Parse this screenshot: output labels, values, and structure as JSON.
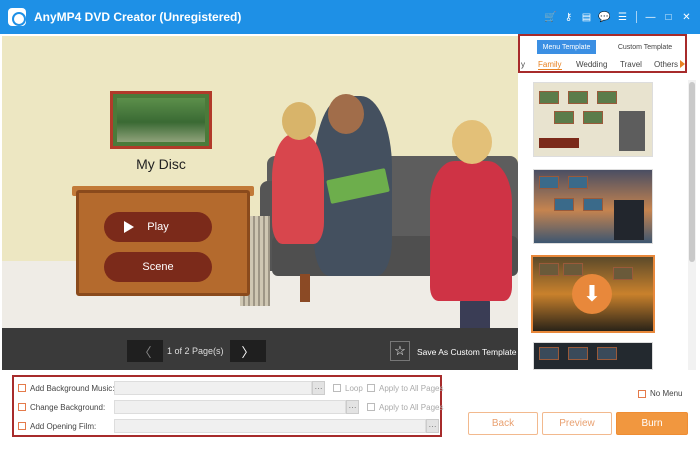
{
  "app": {
    "title": "AnyMP4 DVD Creator (Unregistered)"
  },
  "titlebar_icons": [
    "cart-icon",
    "key-icon",
    "document-icon",
    "chat-icon",
    "menu-icon",
    "minimize-icon",
    "maximize-icon",
    "close-icon"
  ],
  "titlebar_glyphs": {
    "cart": "🛒",
    "key": "⚷",
    "document": "▤",
    "chat": "💬",
    "menu": "☰",
    "minimize": "—",
    "maximize": "□",
    "close": "✕"
  },
  "preview": {
    "disc_title": "My Disc",
    "play_label": "Play",
    "scene_label": "Scene"
  },
  "nav": {
    "prev_glyph": "〈",
    "next_glyph": "〉",
    "page_info": "1 of 2 Page(s)",
    "save_star": "☆",
    "save_label": "Save As Custom Template"
  },
  "templates": {
    "tabs": {
      "menu": "Menu Template",
      "custom": "Custom Template"
    },
    "categories": {
      "partial": "y",
      "family": "Family",
      "wedding": "Wedding",
      "travel": "Travel",
      "others": "Others"
    },
    "active_category": "Family",
    "download_glyph": "⬇"
  },
  "options": {
    "background_music": {
      "label": "Add Background Music:",
      "more": "···",
      "loop": "Loop",
      "apply_all": "Apply to All Pages"
    },
    "change_background": {
      "label": "Change Background:",
      "more": "···",
      "apply_all": "Apply to All Pages"
    },
    "opening_film": {
      "label": "Add Opening Film:",
      "more": "···"
    }
  },
  "no_menu": "No Menu",
  "buttons": {
    "back": "Back",
    "preview": "Preview",
    "burn": "Burn"
  },
  "colors": {
    "titlebar": "#1e90e6",
    "accent_orange": "#f1973f",
    "highlight_frame": "#a72b2b",
    "tab_active": "#3b8fe3"
  }
}
